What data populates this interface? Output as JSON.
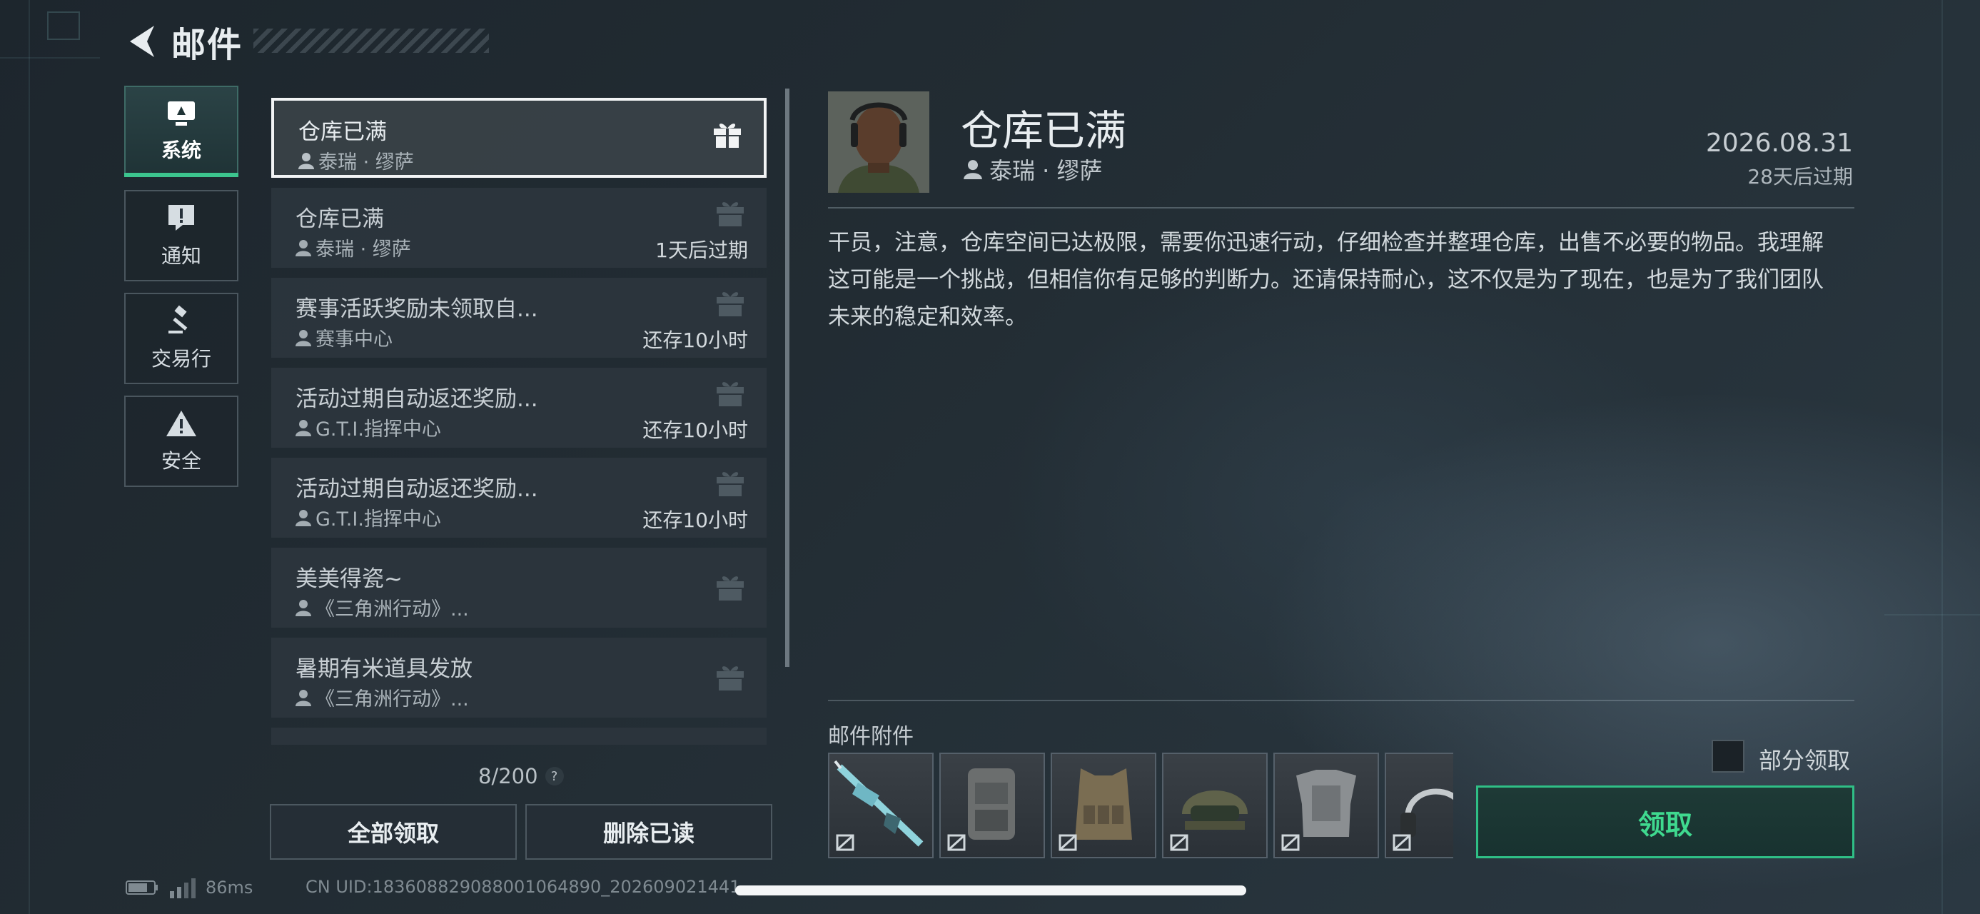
{
  "header": {
    "title": "邮件"
  },
  "categories": [
    {
      "label": "系统",
      "icon": "monitor-icon",
      "active": true
    },
    {
      "label": "通知",
      "icon": "alert-message-icon",
      "active": false
    },
    {
      "label": "交易行",
      "icon": "gavel-icon",
      "active": false
    },
    {
      "label": "安全",
      "icon": "warning-triangle-icon",
      "active": false
    }
  ],
  "mails": [
    {
      "title": "仓库已满",
      "sender": "泰瑞 · 缪萨",
      "expire": "",
      "selected": true,
      "gift": "gift-icon"
    },
    {
      "title": "仓库已满",
      "sender": "泰瑞 · 缪萨",
      "expire": "1天后过期",
      "selected": false,
      "gift": "gift-icon"
    },
    {
      "title": "赛事活跃奖励未领取自...",
      "sender": "赛事中心",
      "expire": "还存10小时",
      "selected": false,
      "gift": "gift-icon"
    },
    {
      "title": "活动过期自动返还奖励...",
      "sender": "G.T.I.指挥中心",
      "expire": "还存10小时",
      "selected": false,
      "gift": "gift-icon"
    },
    {
      "title": "活动过期自动返还奖励...",
      "sender": "G.T.I.指挥中心",
      "expire": "还存10小时",
      "selected": false,
      "gift": "gift-icon"
    },
    {
      "title": "美美得瓷~",
      "sender": "《三角洲行动》...",
      "expire": "",
      "selected": false,
      "gift": "gift-icon"
    },
    {
      "title": "暑期有米道具发放",
      "sender": "《三角洲行动》...",
      "expire": "",
      "selected": false,
      "gift": "gift-icon"
    }
  ],
  "list_footer": {
    "counter": "8/200",
    "help": "?"
  },
  "actions": {
    "claim_all": "全部领取",
    "delete_read": "删除已读"
  },
  "detail": {
    "title": "仓库已满",
    "sender": "泰瑞 · 缪萨",
    "date": "2026.08.31",
    "expire": "28天后过期",
    "body": "干员，注意，仓库空间已达极限，需要你迅速行动，仔细检查并整理仓库，出售不必要的物品。我理解这可能是一个挑战，但相信你有足够的判断力。还请保持耐心，这不仅是为了现在，也是为了我们团队未来的稳定和效率。",
    "attachments_label": "邮件附件",
    "attachments": [
      {
        "name": "rifle",
        "icon": "rifle-icon"
      },
      {
        "name": "backpack",
        "icon": "backpack-icon"
      },
      {
        "name": "chest-rig",
        "icon": "vest-icon"
      },
      {
        "name": "helmet",
        "icon": "helmet-icon"
      },
      {
        "name": "body-armor",
        "icon": "armor-icon"
      },
      {
        "name": "headset",
        "icon": "headset-icon"
      }
    ],
    "partial_claim_label": "部分领取",
    "claim_label": "领取"
  },
  "status_bar": {
    "ping": "86ms",
    "uid": "CN UID:1836088290880010648​90_202609021441"
  },
  "colors": {
    "accent_green": "#3cc58e",
    "claim_text": "#3fd98f",
    "panel": "#2c363e",
    "background": "#222c33"
  }
}
